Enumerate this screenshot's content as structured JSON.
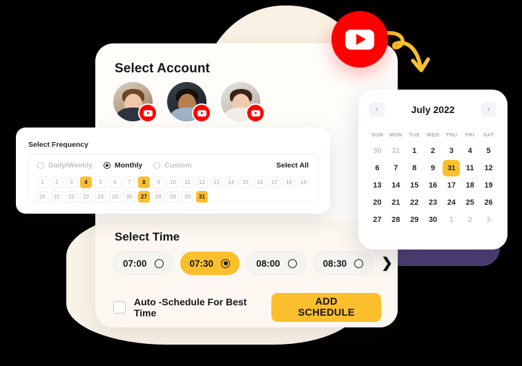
{
  "brand": {
    "accent": "#FBBF2E",
    "youtube_red": "#FF0000",
    "purple": "#4A3F72",
    "cream": "#F8F0E2",
    "icon_main": "youtube-play-icon",
    "arrow_icon": "curved-arrow-icon"
  },
  "account_panel": {
    "title": "Select Account",
    "accounts": [
      {
        "name": "account-avatar-1",
        "badge": "youtube-badge"
      },
      {
        "name": "account-avatar-2",
        "badge": "youtube-badge"
      },
      {
        "name": "account-avatar-3",
        "badge": "youtube-badge"
      }
    ]
  },
  "frequency_panel": {
    "title": "Select Frequency",
    "options": [
      {
        "label": "Daily/Weekly",
        "selected": false
      },
      {
        "label": "Monthly",
        "selected": true
      },
      {
        "label": "Custom",
        "selected": false
      }
    ],
    "select_all_label": "Select All",
    "days": [
      {
        "label": "1",
        "selected": false
      },
      {
        "label": "2",
        "selected": false
      },
      {
        "label": "3",
        "selected": false
      },
      {
        "label": "4",
        "selected": true
      },
      {
        "label": "5",
        "selected": false
      },
      {
        "label": "6",
        "selected": false
      },
      {
        "label": "7",
        "selected": false
      },
      {
        "label": "8",
        "selected": true
      },
      {
        "label": "9",
        "selected": false
      },
      {
        "label": "10",
        "selected": false
      },
      {
        "label": "11",
        "selected": false
      },
      {
        "label": "12",
        "selected": false
      },
      {
        "label": "13",
        "selected": false
      },
      {
        "label": "14",
        "selected": false
      },
      {
        "label": "15",
        "selected": false
      },
      {
        "label": "16",
        "selected": false
      },
      {
        "label": "17",
        "selected": false
      },
      {
        "label": "18",
        "selected": false
      },
      {
        "label": "19",
        "selected": false
      },
      {
        "label": "20",
        "selected": false
      },
      {
        "label": "21",
        "selected": false
      },
      {
        "label": "22",
        "selected": false
      },
      {
        "label": "23",
        "selected": false
      },
      {
        "label": "24",
        "selected": false
      },
      {
        "label": "25",
        "selected": false
      },
      {
        "label": "26",
        "selected": false
      },
      {
        "label": "27",
        "selected": true
      },
      {
        "label": "28",
        "selected": false
      },
      {
        "label": "29",
        "selected": false
      },
      {
        "label": "30",
        "selected": false
      },
      {
        "label": "31",
        "selected": true
      }
    ]
  },
  "calendar": {
    "month_label": "July 2022",
    "prev_icon": "chevron-left-icon",
    "next_icon": "chevron-right-icon",
    "prev_glyph": "‹",
    "next_glyph": "›",
    "weekdays": [
      "SUN",
      "MON",
      "TUE",
      "WED",
      "THU",
      "FRI",
      "SAT"
    ],
    "cells": [
      {
        "label": "30",
        "muted": true,
        "selected": false
      },
      {
        "label": "31",
        "muted": true,
        "selected": false
      },
      {
        "label": "1",
        "muted": false,
        "selected": false
      },
      {
        "label": "2",
        "muted": false,
        "selected": false
      },
      {
        "label": "3",
        "muted": false,
        "selected": false
      },
      {
        "label": "4",
        "muted": false,
        "selected": false
      },
      {
        "label": "5",
        "muted": false,
        "selected": false
      },
      {
        "label": "6",
        "muted": false,
        "selected": false
      },
      {
        "label": "7",
        "muted": false,
        "selected": false
      },
      {
        "label": "8",
        "muted": false,
        "selected": false
      },
      {
        "label": "9",
        "muted": false,
        "selected": false
      },
      {
        "label": "31",
        "muted": false,
        "selected": true
      },
      {
        "label": "11",
        "muted": false,
        "selected": false
      },
      {
        "label": "12",
        "muted": false,
        "selected": false
      },
      {
        "label": "13",
        "muted": false,
        "selected": false
      },
      {
        "label": "14",
        "muted": false,
        "selected": false
      },
      {
        "label": "15",
        "muted": false,
        "selected": false
      },
      {
        "label": "16",
        "muted": false,
        "selected": false
      },
      {
        "label": "17",
        "muted": false,
        "selected": false
      },
      {
        "label": "18",
        "muted": false,
        "selected": false
      },
      {
        "label": "19",
        "muted": false,
        "selected": false
      },
      {
        "label": "20",
        "muted": false,
        "selected": false
      },
      {
        "label": "21",
        "muted": false,
        "selected": false
      },
      {
        "label": "22",
        "muted": false,
        "selected": false
      },
      {
        "label": "23",
        "muted": false,
        "selected": false
      },
      {
        "label": "24",
        "muted": false,
        "selected": false
      },
      {
        "label": "25",
        "muted": false,
        "selected": false
      },
      {
        "label": "26",
        "muted": false,
        "selected": false
      },
      {
        "label": "27",
        "muted": false,
        "selected": false
      },
      {
        "label": "28",
        "muted": false,
        "selected": false
      },
      {
        "label": "29",
        "muted": false,
        "selected": false
      },
      {
        "label": "30",
        "muted": false,
        "selected": false
      },
      {
        "label": "1",
        "muted": true,
        "selected": false
      },
      {
        "label": "2",
        "muted": true,
        "selected": false
      },
      {
        "label": "3",
        "muted": true,
        "selected": false
      }
    ]
  },
  "time_panel": {
    "title": "Select Time",
    "next_glyph": "❯",
    "slots": [
      {
        "label": "07:00",
        "selected": false
      },
      {
        "label": "07:30",
        "selected": true
      },
      {
        "label": "08:00",
        "selected": false
      },
      {
        "label": "08:30",
        "selected": false
      }
    ]
  },
  "actions": {
    "auto_schedule_label": "Auto -Schedule For Best Time",
    "auto_schedule_checked": false,
    "add_schedule_label": "ADD SCHEDULE"
  }
}
